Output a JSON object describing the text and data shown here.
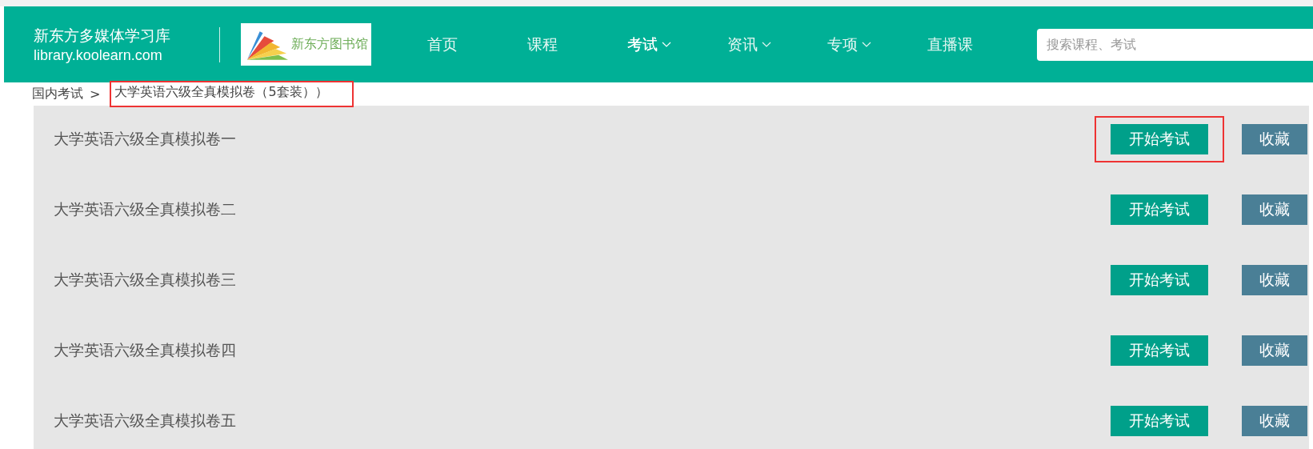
{
  "header": {
    "site_name": "新东方多媒体学习库",
    "site_url": "library.koolearn.com",
    "logo_text": "新东方图书馆",
    "nav": [
      {
        "label": "首页",
        "selected": false,
        "dropdown": false
      },
      {
        "label": "课程",
        "selected": false,
        "dropdown": false
      },
      {
        "label": "考试",
        "selected": true,
        "dropdown": true
      },
      {
        "label": "资讯",
        "selected": false,
        "dropdown": true
      },
      {
        "label": "专项",
        "selected": false,
        "dropdown": true
      },
      {
        "label": "直播课",
        "selected": false,
        "dropdown": false
      }
    ],
    "search": {
      "placeholder": "搜索课程、考试"
    }
  },
  "breadcrumb": {
    "parent": "国内考试",
    "separator": ">",
    "current": "大学英语六级全真模拟卷（5套装））",
    "highlighted": true
  },
  "papers": [
    {
      "title": "大学英语六级全真模拟卷一",
      "start_button": "开始考试",
      "favorite_button": "收藏",
      "highlighted": true
    },
    {
      "title": "大学英语六级全真模拟卷二",
      "start_button": "开始考试",
      "favorite_button": "收藏",
      "highlighted": false
    },
    {
      "title": "大学英语六级全真模拟卷三",
      "start_button": "开始考试",
      "favorite_button": "收藏",
      "highlighted": false
    },
    {
      "title": "大学英语六级全真模拟卷四",
      "start_button": "开始考试",
      "favorite_button": "收藏",
      "highlighted": false
    },
    {
      "title": "大学英语六级全真模拟卷五",
      "start_button": "开始考试",
      "favorite_button": "收藏",
      "highlighted": false
    }
  ]
}
